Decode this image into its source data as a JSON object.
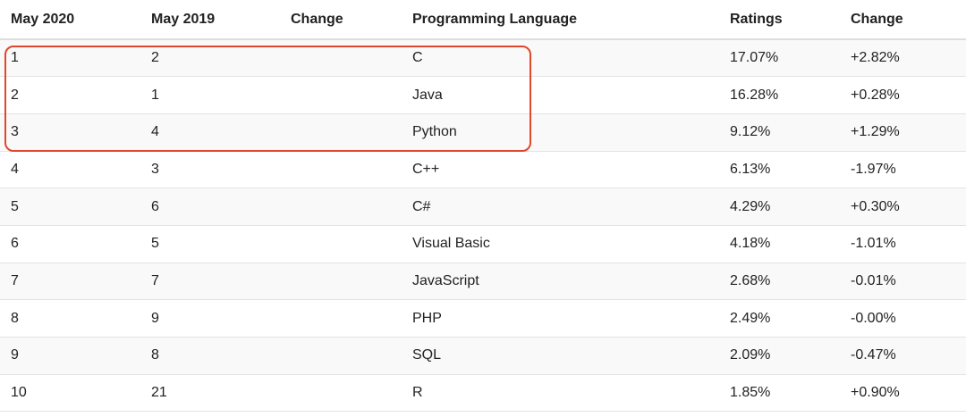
{
  "table": {
    "headers": [
      "May 2020",
      "May 2019",
      "Change",
      "Programming Language",
      "Ratings",
      "Change"
    ],
    "rows": [
      [
        "1",
        "2",
        "",
        "C",
        "17.07%",
        "+2.82%"
      ],
      [
        "2",
        "1",
        "",
        "Java",
        "16.28%",
        "+0.28%"
      ],
      [
        "3",
        "4",
        "",
        "Python",
        "9.12%",
        "+1.29%"
      ],
      [
        "4",
        "3",
        "",
        "C++",
        "6.13%",
        "-1.97%"
      ],
      [
        "5",
        "6",
        "",
        "C#",
        "4.29%",
        "+0.30%"
      ],
      [
        "6",
        "5",
        "",
        "Visual Basic",
        "4.18%",
        "-1.01%"
      ],
      [
        "7",
        "7",
        "",
        "JavaScript",
        "2.68%",
        "-0.01%"
      ],
      [
        "8",
        "9",
        "",
        "PHP",
        "2.49%",
        "-0.00%"
      ],
      [
        "9",
        "8",
        "",
        "SQL",
        "2.09%",
        "-0.47%"
      ],
      [
        "10",
        "21",
        "",
        "R",
        "1.85%",
        "+0.90%"
      ]
    ]
  },
  "highlight": {
    "color": "#e0472d",
    "covers_rows": [
      "1",
      "2",
      "3"
    ]
  }
}
